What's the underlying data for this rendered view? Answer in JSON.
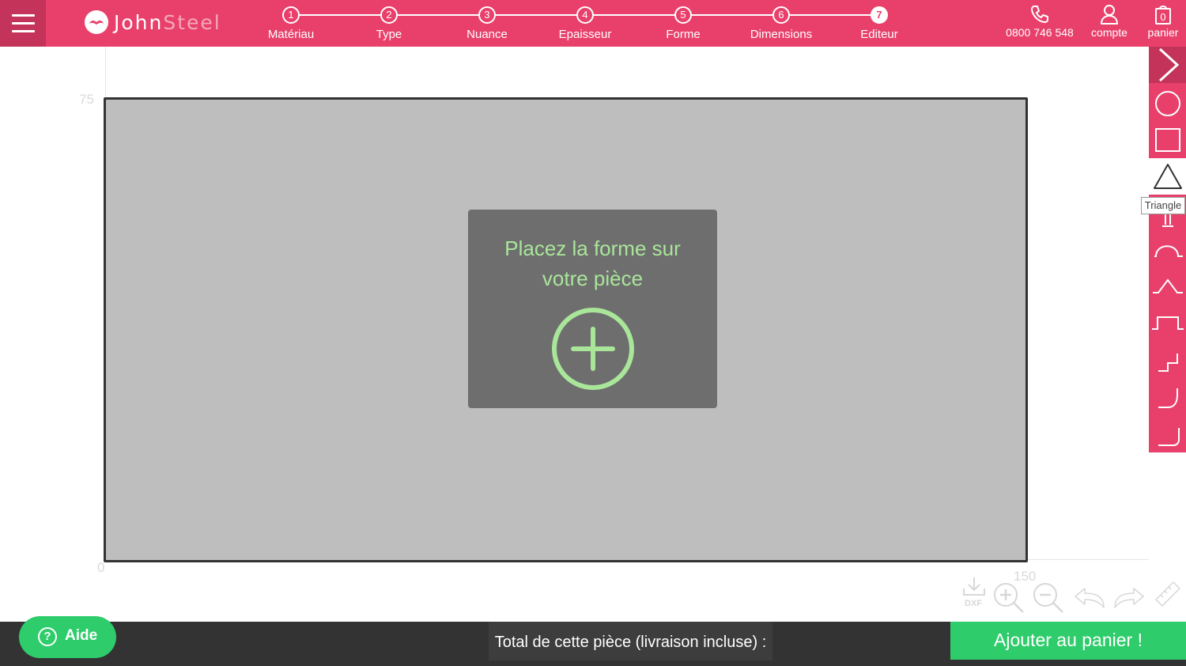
{
  "header": {
    "brand": {
      "part1": "John",
      "part2": "Steel"
    },
    "steps": [
      {
        "num": "1",
        "label": "Matériau"
      },
      {
        "num": "2",
        "label": "Type"
      },
      {
        "num": "3",
        "label": "Nuance"
      },
      {
        "num": "4",
        "label": "Epaisseur"
      },
      {
        "num": "5",
        "label": "Forme"
      },
      {
        "num": "6",
        "label": "Dimensions"
      },
      {
        "num": "7",
        "label": "Editeur"
      }
    ],
    "active_step": "7",
    "phone": "0800 746 548",
    "account_label": "compte",
    "cart_label": "panier",
    "cart_count": "0"
  },
  "canvas": {
    "y_max_label": "75",
    "origin_label": "0",
    "x_max_label": "150",
    "overlay_text_line1": "Placez la forme sur",
    "overlay_text_line2": "votre pièce"
  },
  "toolbar": {
    "tools": [
      "chevron-right",
      "circle",
      "square",
      "triangle",
      "slot",
      "arc",
      "notch-v",
      "notch-rect",
      "step",
      "curve",
      "corner"
    ],
    "tooltip": "Triangle"
  },
  "controls": {
    "dxf_label": "DXF"
  },
  "footer": {
    "help_label": "Aide",
    "total_label": "Total de cette pièce (livraison incluse) :",
    "add_cart_label": "Ajouter au panier !"
  },
  "colors": {
    "brand_pink": "#e8406b",
    "brand_pink_dark": "#c43359",
    "green": "#2ecc6b",
    "overlay_green": "#a9e69a",
    "piece_gray": "#bebebe"
  }
}
